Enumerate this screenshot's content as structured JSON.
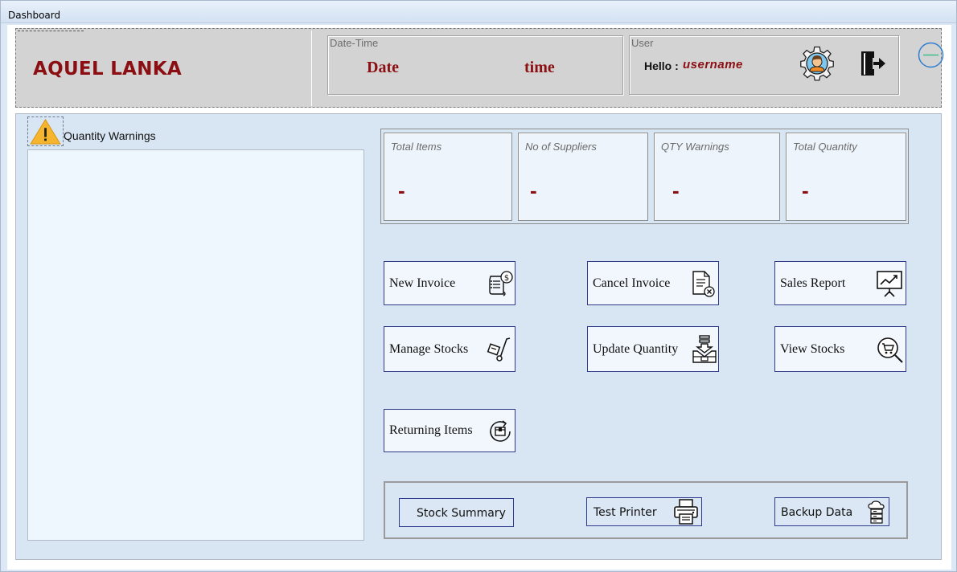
{
  "window": {
    "title": "Dashboard"
  },
  "header": {
    "brand": "AQUEL LANKA",
    "datetime": {
      "group_label": "Date-Time",
      "date": "Date",
      "time": "time"
    },
    "user": {
      "group_label": "User",
      "hello": "Hello :",
      "username": "username"
    },
    "icons": {
      "settings": "user-settings-gear-icon",
      "logout": "logout-door-icon",
      "minimize": "minimize-circle-icon"
    }
  },
  "warnings": {
    "label": "Quantity Warnings",
    "icon": "warning-triangle-icon",
    "items": []
  },
  "stats": [
    {
      "label": "Total Items",
      "value": "-"
    },
    {
      "label": "No of Suppliers",
      "value": "-"
    },
    {
      "label": "QTY  Warnings",
      "value": "-"
    },
    {
      "label": "Total Quantity",
      "value": "-"
    }
  ],
  "actions": {
    "new_invoice": "New Invoice",
    "cancel_invoice": "Cancel Invoice",
    "sales_report": "Sales Report",
    "manage_stocks": "Manage Stocks",
    "update_quantity": "Update Quantity",
    "view_stocks": "View Stocks",
    "returning_items": "Returning Items"
  },
  "tools": {
    "stock_summary": "Stock Summary",
    "test_printer": "Test Printer",
    "backup_data": "Backup Data"
  },
  "colors": {
    "accent": "#8b0e12",
    "button_border": "#2f3a8c",
    "panel_bg": "#d8e5f2"
  }
}
